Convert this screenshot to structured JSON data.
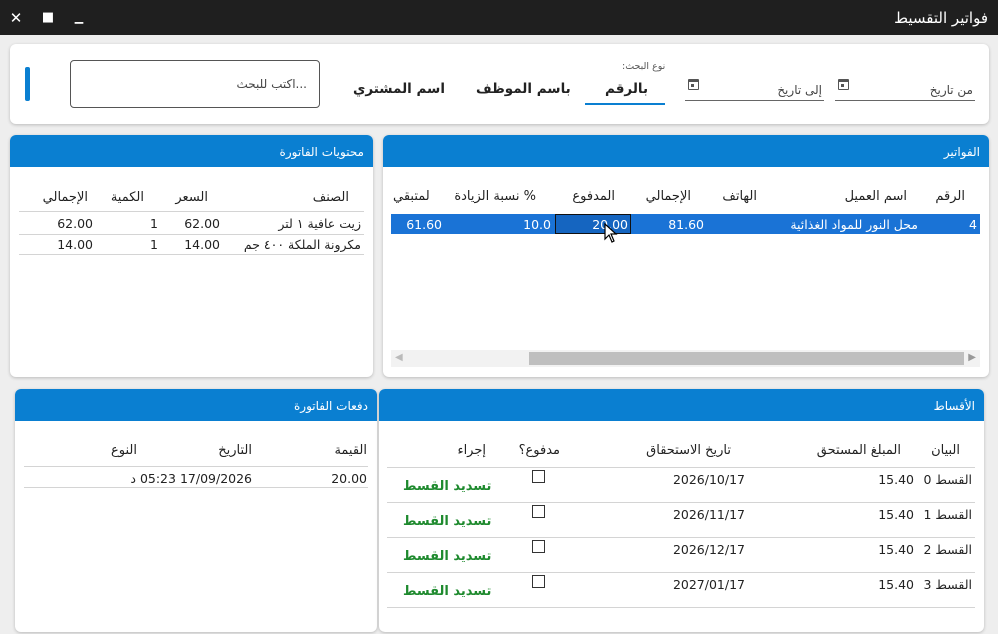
{
  "window": {
    "title": "فواتير التقسيط",
    "close_glyph": "✕",
    "maximize_glyph": "■",
    "minimize_glyph": "▁"
  },
  "search": {
    "from_date_placeholder": "من تاريخ",
    "to_date_placeholder": "إلى تاريخ",
    "search_type_label": "نوع البحث:",
    "tabs": [
      {
        "label": "بالرقم",
        "active": true
      },
      {
        "label": "باسم الموظف",
        "active": false
      },
      {
        "label": "اسم المشتري",
        "active": false
      }
    ],
    "search_placeholder": "اكتب للبحث..."
  },
  "invoices": {
    "title": "الفواتير",
    "columns": [
      "الرقم",
      "اسم العميل",
      "الهاتف",
      "الإجمالي",
      "المدفوع",
      "نسبة الزيادة %",
      "المتبقي"
    ],
    "rows": [
      {
        "number": "4",
        "customer": "محل النور للمواد الغذائية",
        "phone": "",
        "total": "81.60",
        "paid": "20.00",
        "increase": "10.0",
        "remaining": "61.60"
      }
    ]
  },
  "contents": {
    "title": "محتويات الفاتورة",
    "columns": [
      "الصنف",
      "السعر",
      "الكمية",
      "الإجمالي"
    ],
    "rows": [
      {
        "item": "زيت عافية ١ لتر",
        "price": "62.00",
        "qty": "1",
        "total": "62.00"
      },
      {
        "item": "مكرونة الملكة ٤٠٠ جم",
        "price": "14.00",
        "qty": "1",
        "total": "14.00"
      }
    ]
  },
  "installments": {
    "title": "الأقساط",
    "columns": [
      "البيان",
      "المبلغ المستحق",
      "تاريخ الاستحقاق",
      "مدفوع؟",
      "إجراء"
    ],
    "rows": [
      {
        "label": "القسط 0",
        "amount": "15.40",
        "due": "2026/10/17",
        "paid": false,
        "action": "تسديد القسط"
      },
      {
        "label": "القسط 1",
        "amount": "15.40",
        "due": "2026/11/17",
        "paid": false,
        "action": "تسديد القسط"
      },
      {
        "label": "القسط 2",
        "amount": "15.40",
        "due": "2026/12/17",
        "paid": false,
        "action": "تسديد القسط"
      },
      {
        "label": "القسط 3",
        "amount": "15.40",
        "due": "2027/01/17",
        "paid": false,
        "action": "تسديد القسط"
      }
    ]
  },
  "payments": {
    "title": "دفعات الفاتورة",
    "columns": [
      "القيمة",
      "التاريخ",
      "النوع"
    ],
    "rows": [
      {
        "value": "20.00",
        "date": "17/09/2026 05:23 د",
        "type": ""
      }
    ]
  },
  "colors": {
    "accent": "#0a7fd1",
    "selected_row": "#1a73d6",
    "titlebar": "#1f1f1f",
    "action_green": "#1e8a2e"
  }
}
